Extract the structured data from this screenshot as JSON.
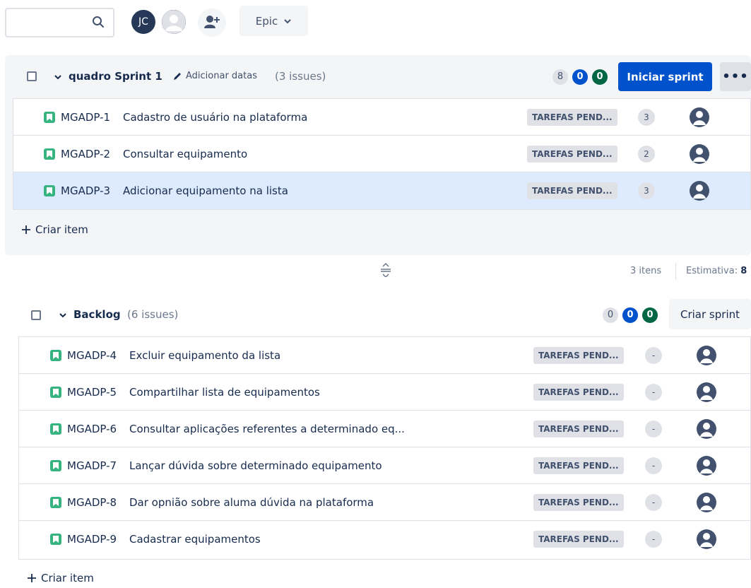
{
  "toolbar": {
    "search_placeholder": "",
    "avatar_initials": "JC",
    "epic_label": "Epic"
  },
  "sprint": {
    "name": "quadro Sprint 1",
    "add_dates": "Adicionar datas",
    "issue_count": "(3 issues)",
    "counts": {
      "todo": "8",
      "in_progress": "0",
      "done": "0"
    },
    "start_button": "Iniciar sprint",
    "more_button": "•••",
    "issues": [
      {
        "key": "MGADP-1",
        "summary": "Cadastro de usuário na plataforma",
        "status": "TAREFAS PEND...",
        "estimate": "3"
      },
      {
        "key": "MGADP-2",
        "summary": "Consultar equipamento",
        "status": "TAREFAS PEND...",
        "estimate": "2"
      },
      {
        "key": "MGADP-3",
        "summary": "Adicionar equipamento na lista",
        "status": "TAREFAS PEND...",
        "estimate": "3"
      }
    ],
    "create_item": "Criar item",
    "footer_items": "3 itens",
    "footer_estimate_label": "Estimativa:",
    "footer_estimate_value": "8"
  },
  "backlog": {
    "name": "Backlog",
    "issue_count": "(6 issues)",
    "counts": {
      "todo": "0",
      "in_progress": "0",
      "done": "0"
    },
    "create_sprint_button": "Criar sprint",
    "issues": [
      {
        "key": "MGADP-4",
        "summary": "Excluir equipamento da lista",
        "status": "TAREFAS PEND...",
        "estimate": "-"
      },
      {
        "key": "MGADP-5",
        "summary": "Compartilhar lista de equipamentos",
        "status": "TAREFAS PEND...",
        "estimate": "-"
      },
      {
        "key": "MGADP-6",
        "summary": "Consultar aplicações referentes a determinado eq...",
        "status": "TAREFAS PEND...",
        "estimate": "-"
      },
      {
        "key": "MGADP-7",
        "summary": "Lançar dúvida sobre determinado equipamento",
        "status": "TAREFAS PEND...",
        "estimate": "-"
      },
      {
        "key": "MGADP-8",
        "summary": "Dar opnião sobre aluma dúvida na plataforma",
        "status": "TAREFAS PEND...",
        "estimate": "-"
      },
      {
        "key": "MGADP-9",
        "summary": "Cadastrar equipamentos",
        "status": "TAREFAS PEND...",
        "estimate": "-"
      }
    ],
    "create_item": "Criar item"
  },
  "colors": {
    "primary": "#0052cc",
    "story": "#36b37e",
    "done": "#006644",
    "selected_row": "#deebff"
  }
}
